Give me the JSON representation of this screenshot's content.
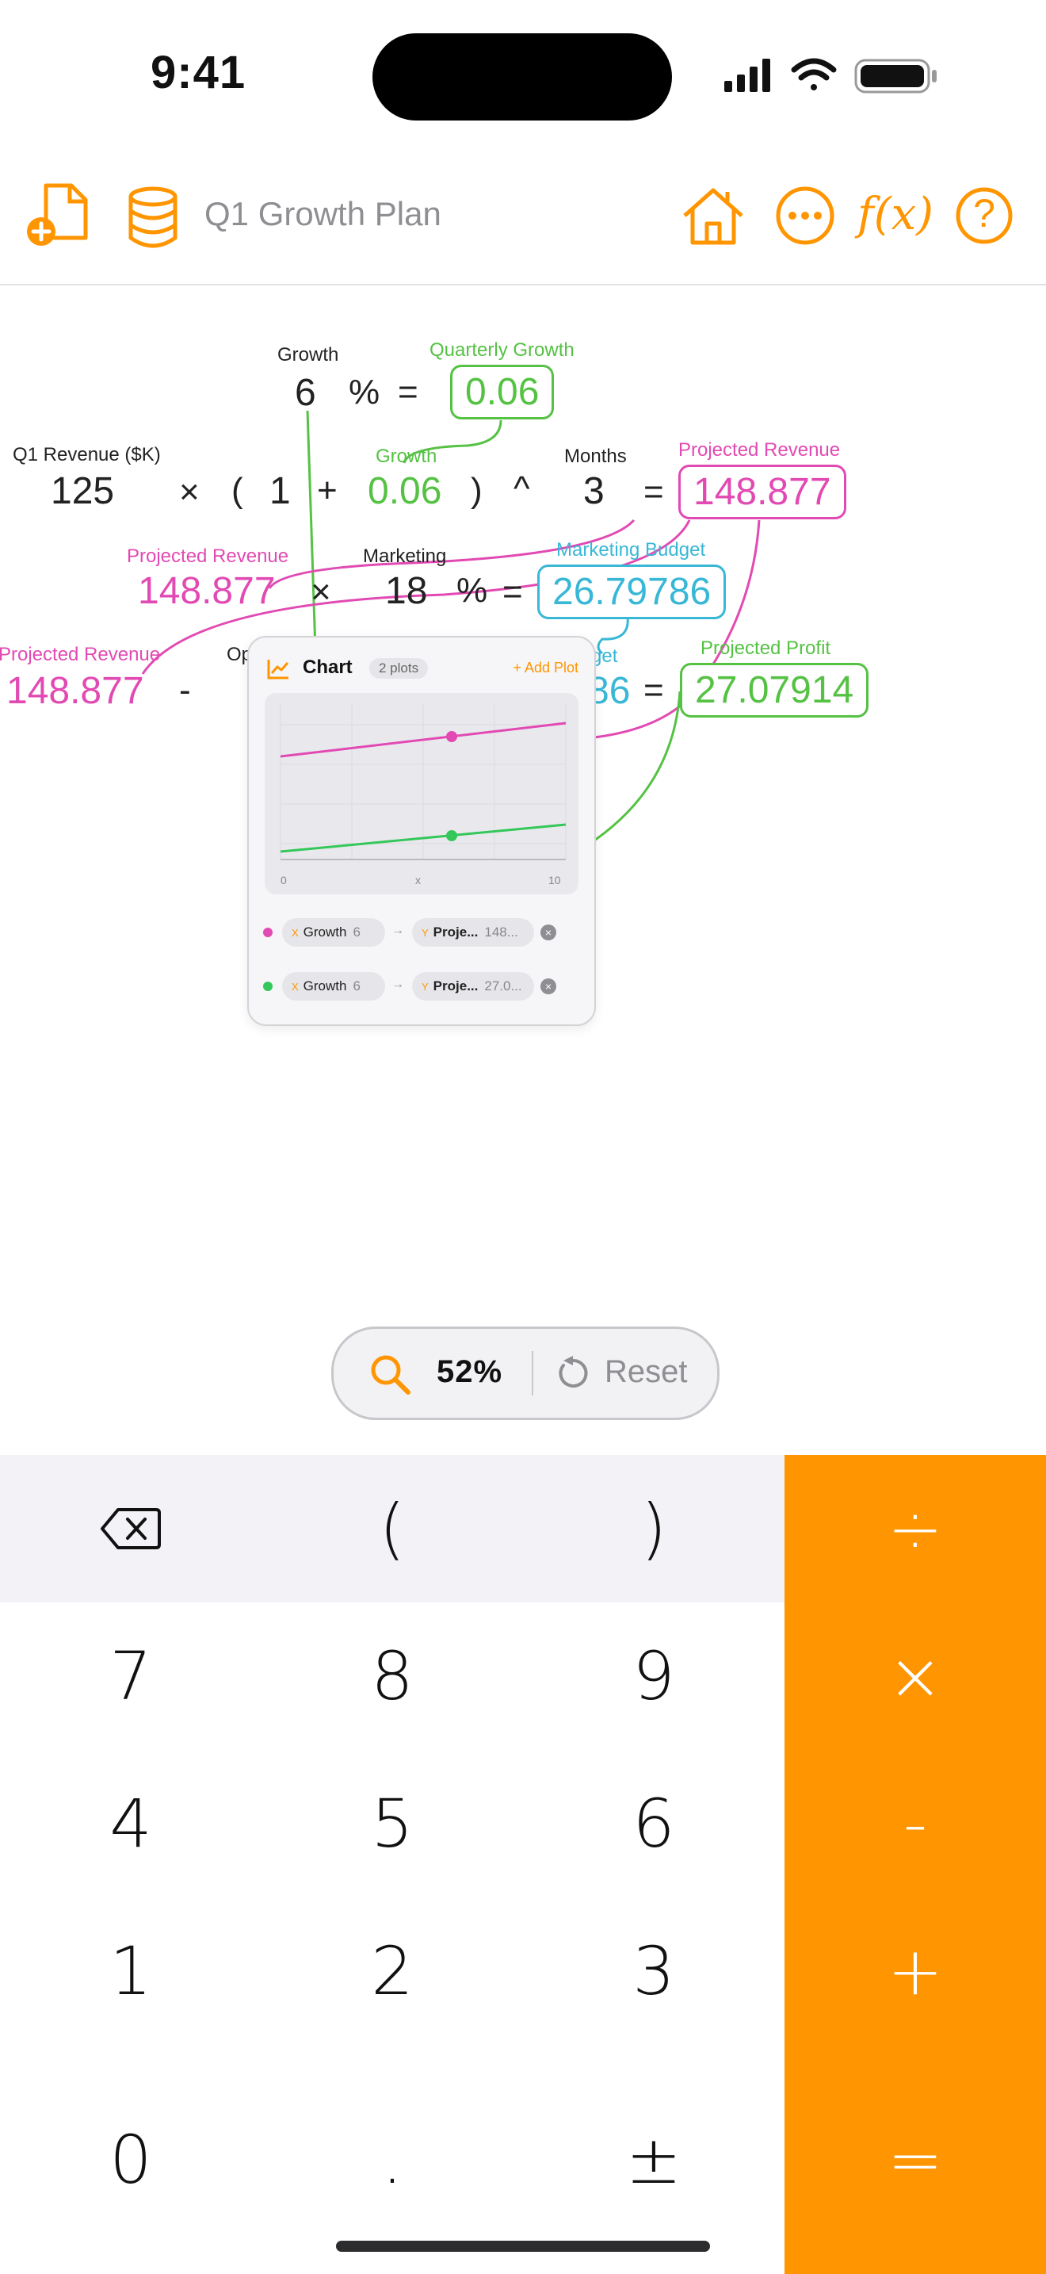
{
  "status_bar": {
    "time": "9:41",
    "icons": [
      "signal-icon",
      "wifi-icon",
      "battery-icon"
    ]
  },
  "toolbar": {
    "doc_title": "Q1 Growth Plan",
    "left_icons": [
      "new-document-icon",
      "database-icon"
    ],
    "right_icons": [
      "home-icon",
      "more-icon",
      "function-icon",
      "help-icon"
    ],
    "function_label": "f(x)",
    "help_label": "?"
  },
  "canvas": {
    "row1": {
      "label": "Growth",
      "value": "6",
      "op1": "%",
      "op2": "=",
      "result_label": "Quarterly Growth",
      "result": "0.06"
    },
    "row2": {
      "label": "Q1 Revenue ($K)",
      "value": "125",
      "op_mul": "×",
      "paren_open": "(",
      "one": "1",
      "op_plus": "+",
      "growth_label": "Growth",
      "growth_value": "0.06",
      "paren_close": ")",
      "op_pow": "^",
      "months_label": "Months",
      "months_value": "3",
      "op_eq": "=",
      "result_label": "Projected Revenue",
      "result": "148.877"
    },
    "row3": {
      "ref_label": "Projected Revenue",
      "ref_value": "148.877",
      "op_mul": "×",
      "marketing_label": "Marketing",
      "marketing_value": "18",
      "op_pct": "%",
      "op_eq": "=",
      "result_label": "Marketing Budget",
      "result": "26.79786"
    },
    "row4": {
      "ref_label": "Projected Revenue",
      "ref_value": "148.877",
      "op_minus": "-",
      "partial_label": "Op",
      "partial_budget_label": "get",
      "partial_budget_value": "86",
      "op_eq": "=",
      "result_label": "Projected Profit",
      "result": "27.07914"
    }
  },
  "chart_card": {
    "title": "Chart",
    "plots_badge": "2 plots",
    "add_plot": "+ Add Plot",
    "x_tick_min": "0",
    "x_tick_mid": "x",
    "x_tick_max": "10",
    "plots": [
      {
        "color": "#e24ab3",
        "x_tag": "X",
        "x_name": "Growth",
        "x_value": "6",
        "y_tag": "Y",
        "y_name": "Proje...",
        "y_value": "148..."
      },
      {
        "color": "#34c759",
        "x_tag": "X",
        "x_name": "Growth",
        "x_value": "6",
        "y_tag": "Y",
        "y_name": "Proje...",
        "y_value": "27.0..."
      }
    ]
  },
  "zoom": {
    "value": "52%",
    "reset_label": "Reset"
  },
  "keypad": {
    "top_row": [
      "⌫",
      "(",
      ")"
    ],
    "digits": [
      [
        "7",
        "8",
        "9"
      ],
      [
        "4",
        "5",
        "6"
      ],
      [
        "1",
        "2",
        "3"
      ],
      [
        "0",
        ".",
        "±"
      ]
    ],
    "operators": [
      "÷",
      "×",
      "-",
      "+",
      "="
    ]
  },
  "colors": {
    "accent": "#ff9500",
    "projected_revenue": "#e24ab3",
    "growth": "#55c244",
    "marketing_budget": "#38b7d6"
  }
}
